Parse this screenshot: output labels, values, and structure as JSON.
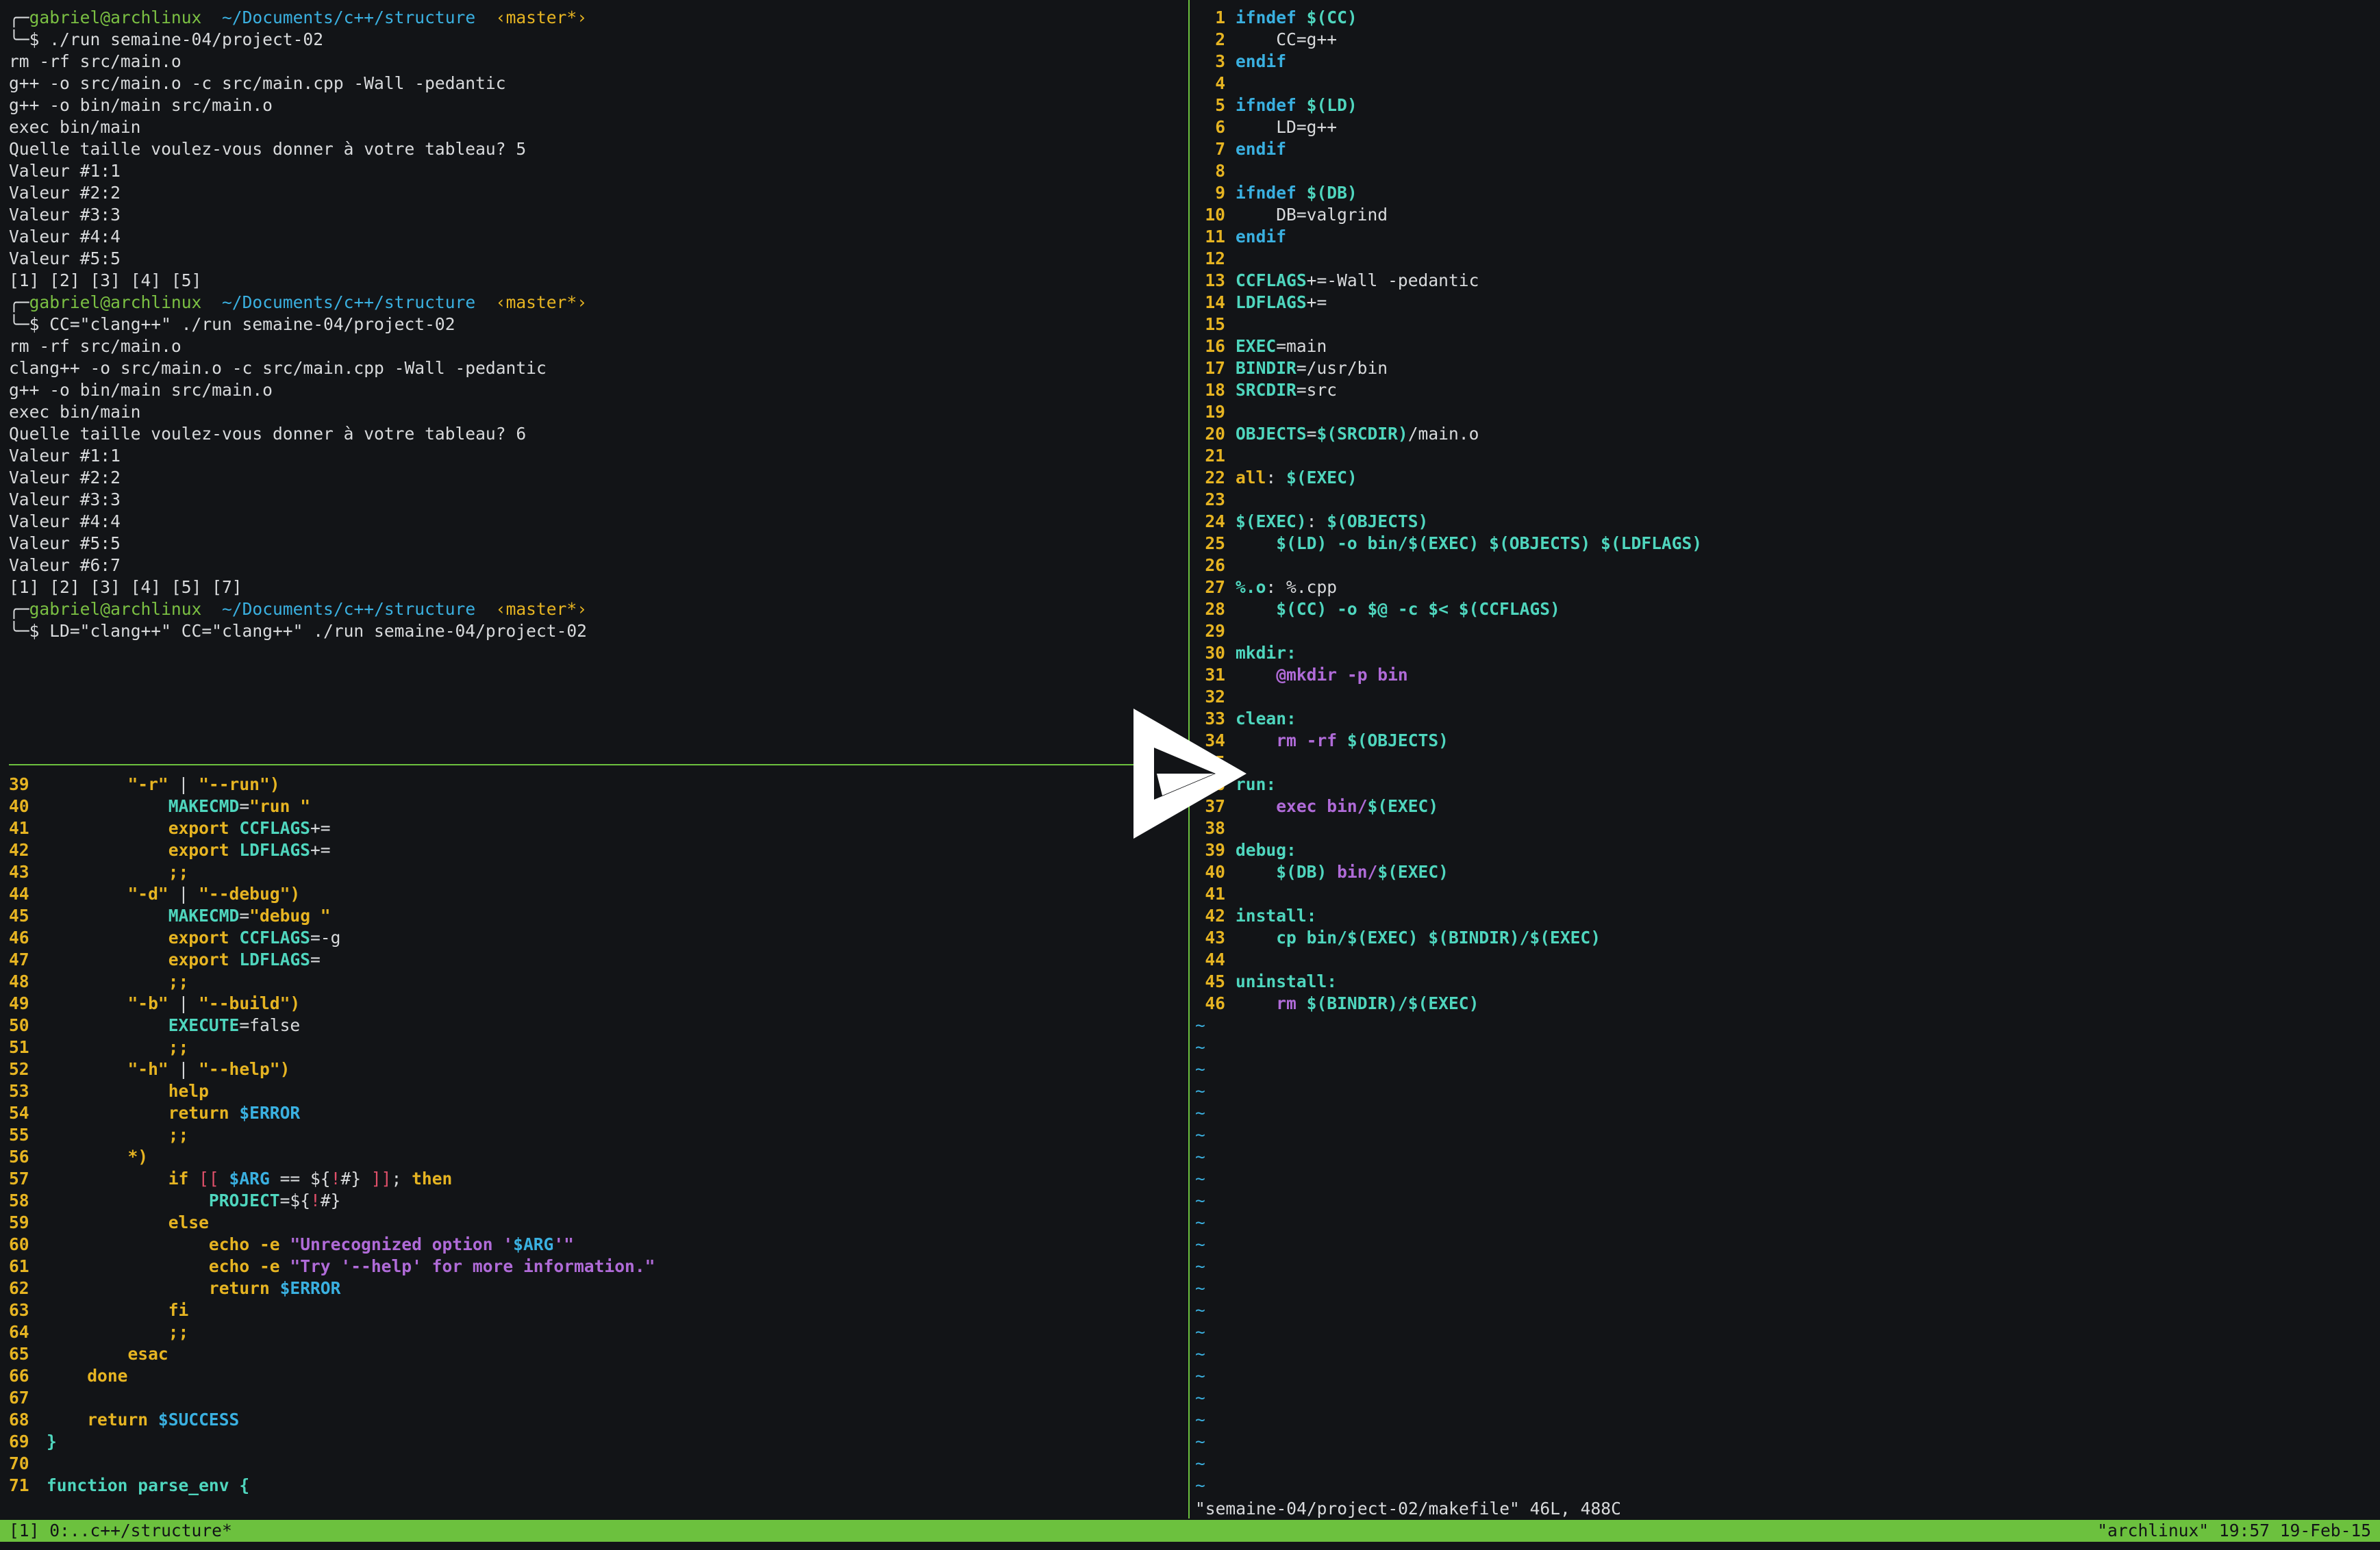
{
  "terminal": {
    "lines": [
      {
        "kind": "prompt",
        "user": "gabriel@archlinux",
        "path": "~/Documents/c++/structure",
        "branch": "‹master*›"
      },
      {
        "kind": "command",
        "text": "./run semaine-04/project-02"
      },
      {
        "kind": "out",
        "text": "rm -rf src/main.o"
      },
      {
        "kind": "out",
        "text": "g++ -o src/main.o -c src/main.cpp -Wall -pedantic"
      },
      {
        "kind": "out",
        "text": "g++ -o bin/main src/main.o"
      },
      {
        "kind": "out",
        "text": "exec bin/main"
      },
      {
        "kind": "out",
        "text": "Quelle taille voulez-vous donner à votre tableau? 5"
      },
      {
        "kind": "out",
        "text": "Valeur #1:1"
      },
      {
        "kind": "out",
        "text": "Valeur #2:2"
      },
      {
        "kind": "out",
        "text": "Valeur #3:3"
      },
      {
        "kind": "out",
        "text": "Valeur #4:4"
      },
      {
        "kind": "out",
        "text": "Valeur #5:5"
      },
      {
        "kind": "out",
        "text": "[1] [2] [3] [4] [5]"
      },
      {
        "kind": "prompt",
        "user": "gabriel@archlinux",
        "path": "~/Documents/c++/structure",
        "branch": "‹master*›"
      },
      {
        "kind": "command",
        "text": "CC=\"clang++\" ./run semaine-04/project-02"
      },
      {
        "kind": "out",
        "text": "rm -rf src/main.o"
      },
      {
        "kind": "out",
        "text": "clang++ -o src/main.o -c src/main.cpp -Wall -pedantic"
      },
      {
        "kind": "out",
        "text": "g++ -o bin/main src/main.o"
      },
      {
        "kind": "out",
        "text": "exec bin/main"
      },
      {
        "kind": "out",
        "text": "Quelle taille voulez-vous donner à votre tableau? 6"
      },
      {
        "kind": "out",
        "text": "Valeur #1:1"
      },
      {
        "kind": "out",
        "text": "Valeur #2:2"
      },
      {
        "kind": "out",
        "text": "Valeur #3:3"
      },
      {
        "kind": "out",
        "text": "Valeur #4:4"
      },
      {
        "kind": "out",
        "text": "Valeur #5:5"
      },
      {
        "kind": "out",
        "text": "Valeur #6:7"
      },
      {
        "kind": "out",
        "text": "[1] [2] [3] [4] [5] [7]"
      },
      {
        "kind": "prompt",
        "user": "gabriel@archlinux",
        "path": "~/Documents/c++/structure",
        "branch": "‹master*›"
      },
      {
        "kind": "command",
        "text": "LD=\"clang++\" CC=\"clang++\" ./run semaine-04/project-02"
      }
    ],
    "prompt_top": "╭─",
    "prompt_bottom": "╰─$ "
  },
  "script_editor": {
    "lines": [
      {
        "n": "39",
        "tokens": [
          [
            "pl",
            "        "
          ],
          [
            "str",
            "\"-r\""
          ],
          [
            "pl",
            " | "
          ],
          [
            "str",
            "\"--run\""
          ],
          [
            "str",
            ")"
          ]
        ]
      },
      {
        "n": "40",
        "tokens": [
          [
            "pl",
            "            "
          ],
          [
            "var",
            "MAKECMD"
          ],
          [
            "pl",
            "="
          ],
          [
            "str",
            "\"run \""
          ]
        ]
      },
      {
        "n": "41",
        "tokens": [
          [
            "pl",
            "            "
          ],
          [
            "str",
            "export "
          ],
          [
            "var",
            "CCFLAGS"
          ],
          [
            "pl",
            "+="
          ]
        ]
      },
      {
        "n": "42",
        "tokens": [
          [
            "pl",
            "            "
          ],
          [
            "str",
            "export "
          ],
          [
            "var",
            "LDFLAGS"
          ],
          [
            "pl",
            "+="
          ]
        ]
      },
      {
        "n": "43",
        "tokens": [
          [
            "pl",
            "            "
          ],
          [
            "str",
            ";;"
          ]
        ]
      },
      {
        "n": "44",
        "tokens": [
          [
            "pl",
            "        "
          ],
          [
            "str",
            "\"-d\""
          ],
          [
            "pl",
            " | "
          ],
          [
            "str",
            "\"--debug\""
          ],
          [
            "str",
            ")"
          ]
        ]
      },
      {
        "n": "45",
        "tokens": [
          [
            "pl",
            "            "
          ],
          [
            "var",
            "MAKECMD"
          ],
          [
            "pl",
            "="
          ],
          [
            "str",
            "\"debug \""
          ]
        ]
      },
      {
        "n": "46",
        "tokens": [
          [
            "pl",
            "            "
          ],
          [
            "str",
            "export "
          ],
          [
            "var",
            "CCFLAGS"
          ],
          [
            "pl",
            "=-g"
          ]
        ]
      },
      {
        "n": "47",
        "tokens": [
          [
            "pl",
            "            "
          ],
          [
            "str",
            "export "
          ],
          [
            "var",
            "LDFLAGS"
          ],
          [
            "pl",
            "="
          ]
        ]
      },
      {
        "n": "48",
        "tokens": [
          [
            "pl",
            "            "
          ],
          [
            "str",
            ";;"
          ]
        ]
      },
      {
        "n": "49",
        "tokens": [
          [
            "pl",
            "        "
          ],
          [
            "str",
            "\"-b\""
          ],
          [
            "pl",
            " | "
          ],
          [
            "str",
            "\"--build\""
          ],
          [
            "str",
            ")"
          ]
        ]
      },
      {
        "n": "50",
        "tokens": [
          [
            "pl",
            "            "
          ],
          [
            "var",
            "EXECUTE"
          ],
          [
            "pl",
            "=false"
          ]
        ]
      },
      {
        "n": "51",
        "tokens": [
          [
            "pl",
            "            "
          ],
          [
            "str",
            ";;"
          ]
        ]
      },
      {
        "n": "52",
        "tokens": [
          [
            "pl",
            "        "
          ],
          [
            "str",
            "\"-h\""
          ],
          [
            "pl",
            " | "
          ],
          [
            "str",
            "\"--help\""
          ],
          [
            "str",
            ")"
          ]
        ]
      },
      {
        "n": "53",
        "tokens": [
          [
            "pl",
            "            "
          ],
          [
            "str",
            "help"
          ]
        ]
      },
      {
        "n": "54",
        "tokens": [
          [
            "pl",
            "            "
          ],
          [
            "str",
            "return "
          ],
          [
            "kw",
            "$ERROR"
          ]
        ]
      },
      {
        "n": "55",
        "tokens": [
          [
            "pl",
            "            "
          ],
          [
            "str",
            ";;"
          ]
        ]
      },
      {
        "n": "56",
        "tokens": [
          [
            "pl",
            "        "
          ],
          [
            "str",
            "*)"
          ]
        ]
      },
      {
        "n": "57",
        "tokens": [
          [
            "pl",
            "            "
          ],
          [
            "str",
            "if "
          ],
          [
            "sq",
            "[[ "
          ],
          [
            "kw",
            "$ARG"
          ],
          [
            "pl",
            " == "
          ],
          [
            "pl",
            "${"
          ],
          [
            "sq",
            "!"
          ],
          [
            "pl",
            "#} "
          ],
          [
            "sq",
            "]]"
          ],
          [
            "pl",
            "; "
          ],
          [
            "str",
            "then"
          ]
        ]
      },
      {
        "n": "58",
        "tokens": [
          [
            "pl",
            "                "
          ],
          [
            "var",
            "PROJECT"
          ],
          [
            "pl",
            "="
          ],
          [
            "pl",
            "${"
          ],
          [
            "sq",
            "!"
          ],
          [
            "pl",
            "#}"
          ]
        ]
      },
      {
        "n": "59",
        "tokens": [
          [
            "pl",
            "            "
          ],
          [
            "str",
            "else"
          ]
        ]
      },
      {
        "n": "60",
        "tokens": [
          [
            "pl",
            "                "
          ],
          [
            "str",
            "echo -e "
          ],
          [
            "pu",
            "\"Unrecognized option '"
          ],
          [
            "kw",
            "$ARG"
          ],
          [
            "pu",
            "'\""
          ]
        ]
      },
      {
        "n": "61",
        "tokens": [
          [
            "pl",
            "                "
          ],
          [
            "str",
            "echo -e "
          ],
          [
            "pu",
            "\"Try '--help' for more information.\""
          ]
        ]
      },
      {
        "n": "62",
        "tokens": [
          [
            "pl",
            "                "
          ],
          [
            "str",
            "return "
          ],
          [
            "kw",
            "$ERROR"
          ]
        ]
      },
      {
        "n": "63",
        "tokens": [
          [
            "pl",
            "            "
          ],
          [
            "str",
            "fi"
          ]
        ]
      },
      {
        "n": "64",
        "tokens": [
          [
            "pl",
            "            "
          ],
          [
            "str",
            ";;"
          ]
        ]
      },
      {
        "n": "65",
        "tokens": [
          [
            "pl",
            "        "
          ],
          [
            "str",
            "esac"
          ]
        ]
      },
      {
        "n": "66",
        "tokens": [
          [
            "pl",
            "    "
          ],
          [
            "str",
            "done"
          ]
        ]
      },
      {
        "n": "67",
        "tokens": []
      },
      {
        "n": "68",
        "tokens": [
          [
            "pl",
            "    "
          ],
          [
            "str",
            "return "
          ],
          [
            "kw",
            "$SUCCESS"
          ]
        ]
      },
      {
        "n": "69",
        "tokens": [
          [
            "fn",
            "}"
          ]
        ]
      },
      {
        "n": "70",
        "tokens": []
      },
      {
        "n": "71",
        "tokens": [
          [
            "fn",
            "function parse_env {"
          ]
        ]
      }
    ]
  },
  "makefile_editor": {
    "lines": [
      {
        "n": "1",
        "tokens": [
          [
            "kw",
            "ifndef "
          ],
          [
            "var",
            "$(CC)"
          ]
        ]
      },
      {
        "n": "2",
        "tokens": [
          [
            "pl",
            "    CC=g++"
          ]
        ]
      },
      {
        "n": "3",
        "tokens": [
          [
            "kw",
            "endif"
          ]
        ]
      },
      {
        "n": "4",
        "tokens": []
      },
      {
        "n": "5",
        "tokens": [
          [
            "kw",
            "ifndef "
          ],
          [
            "var",
            "$(LD)"
          ]
        ]
      },
      {
        "n": "6",
        "tokens": [
          [
            "pl",
            "    LD=g++"
          ]
        ]
      },
      {
        "n": "7",
        "tokens": [
          [
            "kw",
            "endif"
          ]
        ]
      },
      {
        "n": "8",
        "tokens": []
      },
      {
        "n": "9",
        "tokens": [
          [
            "kw",
            "ifndef "
          ],
          [
            "var",
            "$(DB)"
          ]
        ]
      },
      {
        "n": "10",
        "tokens": [
          [
            "pl",
            "    DB=valgrind"
          ]
        ]
      },
      {
        "n": "11",
        "tokens": [
          [
            "kw",
            "endif"
          ]
        ]
      },
      {
        "n": "12",
        "tokens": []
      },
      {
        "n": "13",
        "tokens": [
          [
            "var",
            "CCFLAGS"
          ],
          [
            "pl",
            "+=-Wall -pedantic"
          ]
        ]
      },
      {
        "n": "14",
        "tokens": [
          [
            "var",
            "LDFLAGS"
          ],
          [
            "pl",
            "+="
          ]
        ]
      },
      {
        "n": "15",
        "tokens": []
      },
      {
        "n": "16",
        "tokens": [
          [
            "var",
            "EXEC"
          ],
          [
            "pl",
            "=main"
          ]
        ]
      },
      {
        "n": "17",
        "tokens": [
          [
            "var",
            "BINDIR"
          ],
          [
            "pl",
            "=/usr/bin"
          ]
        ]
      },
      {
        "n": "18",
        "tokens": [
          [
            "var",
            "SRCDIR"
          ],
          [
            "pl",
            "=src"
          ]
        ]
      },
      {
        "n": "19",
        "tokens": []
      },
      {
        "n": "20",
        "tokens": [
          [
            "var",
            "OBJECTS"
          ],
          [
            "pl",
            "="
          ],
          [
            "var",
            "$(SRCDIR)"
          ],
          [
            "pl",
            "/main.o"
          ]
        ]
      },
      {
        "n": "21",
        "tokens": []
      },
      {
        "n": "22",
        "tokens": [
          [
            "tgt",
            "all"
          ],
          [
            "pl",
            ": "
          ],
          [
            "var",
            "$(EXEC)"
          ]
        ]
      },
      {
        "n": "23",
        "tokens": []
      },
      {
        "n": "24",
        "tokens": [
          [
            "var",
            "$(EXEC)"
          ],
          [
            "pl",
            ": "
          ],
          [
            "var",
            "$(OBJECTS)"
          ]
        ]
      },
      {
        "n": "25",
        "tokens": [
          [
            "pl",
            "    "
          ],
          [
            "var",
            "$(LD) -o bin/$(EXEC) $(OBJECTS) $(LDFLAGS)"
          ]
        ]
      },
      {
        "n": "26",
        "tokens": []
      },
      {
        "n": "27",
        "tokens": [
          [
            "var",
            "%.o"
          ],
          [
            "pl",
            ": %.cpp"
          ]
        ]
      },
      {
        "n": "28",
        "tokens": [
          [
            "pl",
            "    "
          ],
          [
            "var",
            "$(CC) -o $@ -c $< $(CCFLAGS)"
          ]
        ]
      },
      {
        "n": "29",
        "tokens": []
      },
      {
        "n": "30",
        "tokens": [
          [
            "var",
            "mkdir:"
          ]
        ]
      },
      {
        "n": "31",
        "tokens": [
          [
            "pl",
            "    "
          ],
          [
            "bi",
            "@mkdir -p bin"
          ]
        ]
      },
      {
        "n": "32",
        "tokens": []
      },
      {
        "n": "33",
        "tokens": [
          [
            "var",
            "clean:"
          ]
        ]
      },
      {
        "n": "34",
        "tokens": [
          [
            "pl",
            "    "
          ],
          [
            "bi",
            "rm -rf "
          ],
          [
            "var",
            "$(OBJECTS)"
          ]
        ]
      },
      {
        "n": "35",
        "tokens": []
      },
      {
        "n": "36",
        "tokens": [
          [
            "var",
            "run:"
          ]
        ]
      },
      {
        "n": "37",
        "tokens": [
          [
            "pl",
            "    "
          ],
          [
            "bi",
            "exec bin/"
          ],
          [
            "var",
            "$(EXEC)"
          ]
        ]
      },
      {
        "n": "38",
        "tokens": []
      },
      {
        "n": "39",
        "tokens": [
          [
            "var",
            "debug:"
          ]
        ]
      },
      {
        "n": "40",
        "tokens": [
          [
            "pl",
            "    "
          ],
          [
            "var",
            "$(DB) "
          ],
          [
            "bi",
            "bin/"
          ],
          [
            "var",
            "$(EXEC)"
          ]
        ]
      },
      {
        "n": "41",
        "tokens": []
      },
      {
        "n": "42",
        "tokens": [
          [
            "var",
            "install:"
          ]
        ]
      },
      {
        "n": "43",
        "tokens": [
          [
            "pl",
            "    "
          ],
          [
            "var",
            "cp bin/$(EXEC) $(BINDIR)/$(EXEC)"
          ]
        ]
      },
      {
        "n": "44",
        "tokens": []
      },
      {
        "n": "45",
        "tokens": [
          [
            "var",
            "uninstall:"
          ]
        ]
      },
      {
        "n": "46",
        "tokens": [
          [
            "pl",
            "    "
          ],
          [
            "bi",
            "rm "
          ],
          [
            "var",
            "$(BINDIR)/$(EXEC)"
          ]
        ]
      }
    ],
    "empty_marker": "~",
    "empty_line_count": 22,
    "message": "\"semaine-04/project-02/makefile\" 46L, 488C"
  },
  "status_bar": {
    "left": "[1] 0:..c++/structure*",
    "right": "\"archlinux\" 19:57 19-Feb-15"
  },
  "colors": {
    "background": "#121417",
    "separator": "#6cc13e",
    "status_bar": "#6cc13e",
    "line_number": "#e6b422"
  },
  "overlay": {
    "icon": "play-logo-icon"
  }
}
